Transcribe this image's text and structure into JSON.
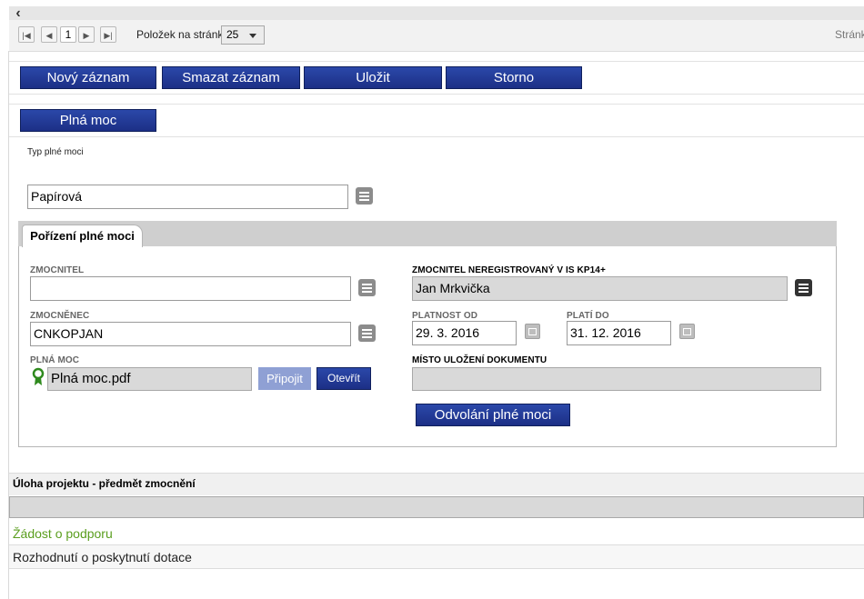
{
  "pager": {
    "page": "1",
    "per_page_label": "Položek na stránku",
    "per_page_value": "25",
    "pages_label": "Stránk"
  },
  "toolbar": {
    "new_label": "Nový záznam",
    "delete_label": "Smazat záznam",
    "save_label": "Uložit",
    "cancel_label": "Storno"
  },
  "power_button_label": "Plná moc",
  "power_type": {
    "label": "Typ plné moci",
    "value": "Papírová"
  },
  "tab_label": "Pořízení plné moci",
  "form": {
    "zmocnitel_label": "ZMOCNITEL",
    "zmocnitel_value": "",
    "zmocnenec_label": "ZMOCNĚNEC",
    "zmocnenec_value": "CNKOPJAN",
    "plna_moc_label": "PLNÁ MOC",
    "plna_moc_file": "Plná moc.pdf",
    "attach_label": "Připojit",
    "open_label": "Otevřít",
    "unregistered_label": "ZMOCNITEL NEREGISTROVANÝ V IS KP14+",
    "unregistered_value": "Jan Mrkvička",
    "valid_from_label": "PLATNOST OD",
    "valid_from_value": "29. 3. 2016",
    "valid_to_label": "PLATÍ DO",
    "valid_to_value": "31. 12. 2016",
    "storage_label": "MÍSTO ULOŽENÍ DOKUMENTU",
    "storage_value": "",
    "revoke_label": "Odvolání plné moci"
  },
  "section": {
    "title": "Úloha projektu - předmět zmocnění",
    "rows": [
      {
        "label": "Žádost o podporu",
        "color": "#5a9e1e"
      },
      {
        "label": "Rozhodnutí o poskytnutí dotace",
        "color": "#222222"
      }
    ]
  },
  "colors": {
    "button_blue": "#1f3590",
    "link_green": "#5a9e1e"
  }
}
